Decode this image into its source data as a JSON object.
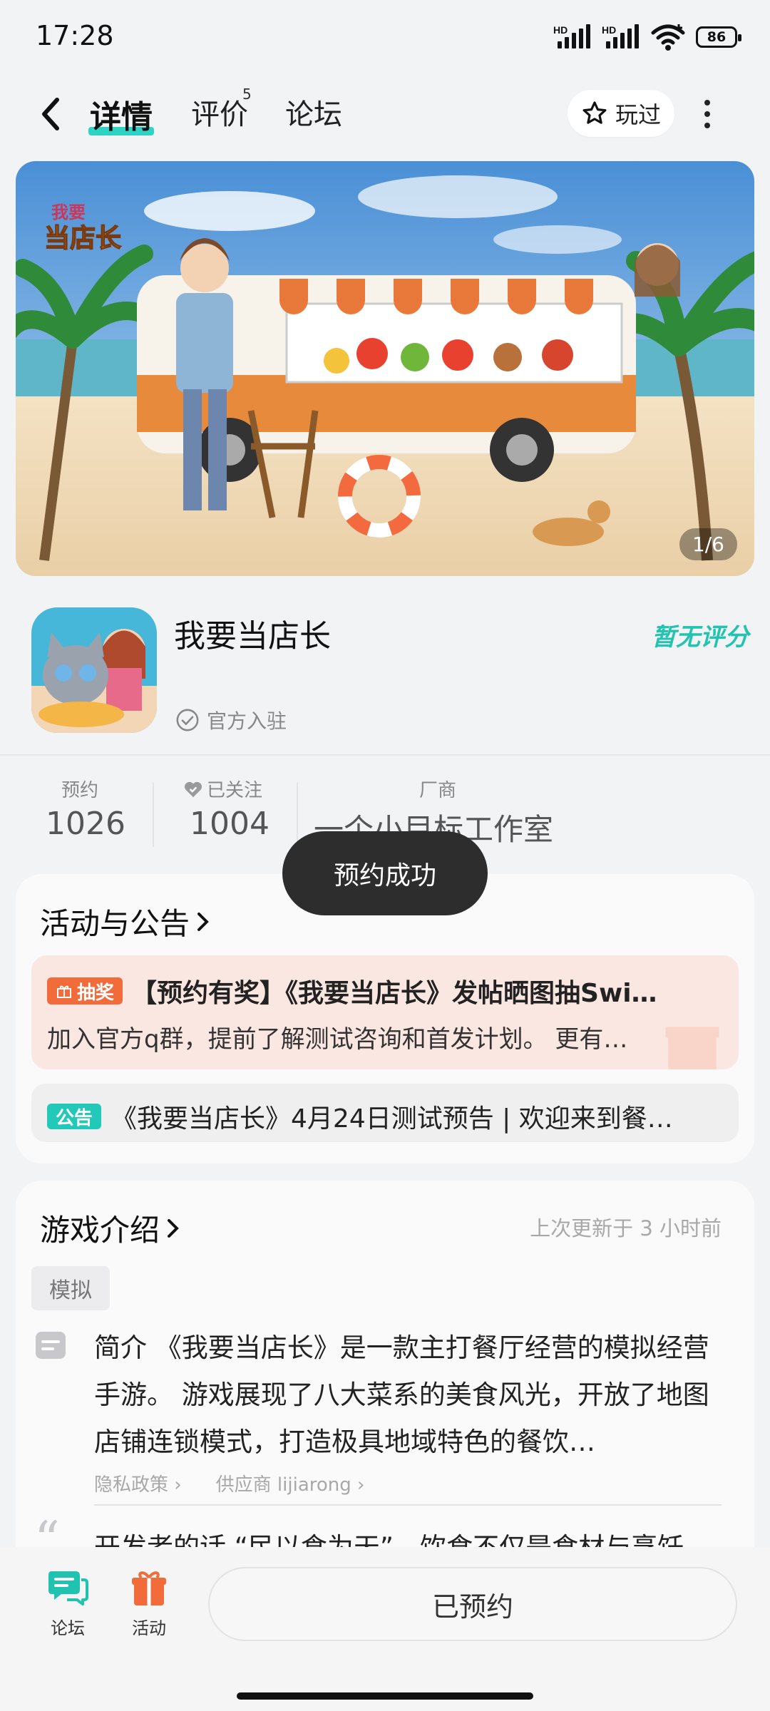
{
  "status_bar": {
    "time": "17:28",
    "hd1": "HD",
    "hd2": "HD",
    "battery": "86"
  },
  "nav": {
    "tabs": [
      {
        "label": "详情",
        "active": true
      },
      {
        "label": "评价",
        "badge": "5"
      },
      {
        "label": "论坛"
      }
    ],
    "played_label": "玩过"
  },
  "banner": {
    "logo_text": "我要当店长",
    "counter": "1/6"
  },
  "app": {
    "name": "我要当店长",
    "official_label": "官方入驻",
    "rating_label": "暂无评分"
  },
  "stats": {
    "reserve_label": "预约",
    "reserve_value": "1026",
    "follow_label": "已关注",
    "follow_value": "1004",
    "vendor_label": "厂商",
    "vendor_value": "一个小目标工作室"
  },
  "toast": "预约成功",
  "activities": {
    "title": "活动与公告",
    "items": [
      {
        "tag": "抽奖",
        "tag_color": "#f26b3a",
        "title": "【预约有奖】《我要当店长》发帖晒图抽Swi…",
        "desc": "加入官方q群，提前了解测试咨询和首发计划。 更有…"
      },
      {
        "tag": "公告",
        "tag_color": "#22c9b8",
        "title": "《我要当店长》4月24日测试预告 | 欢迎来到餐…"
      }
    ]
  },
  "intro": {
    "title": "游戏介绍",
    "updated": "上次更新于 3 小时前",
    "chip": "模拟",
    "text": "简介 《我要当店长》是一款主打餐厅经营的模拟经营手游。 游戏展现了八大菜系的美食风光，开放了地图店铺连锁模式，打造极具地域特色的餐饮…",
    "privacy_link": "隐私政策 ›",
    "supplier_link": "供应商 lijiarong ›",
    "dev_words": "开发者的话 “民以食为天”，饮食不仅是食材与烹饪"
  },
  "bottom": {
    "forum_label": "论坛",
    "activity_label": "活动",
    "reserved_label": "已预约"
  },
  "colors": {
    "accent": "#22c3b0",
    "lottery": "#f26b3a",
    "notice": "#22c9b8"
  }
}
